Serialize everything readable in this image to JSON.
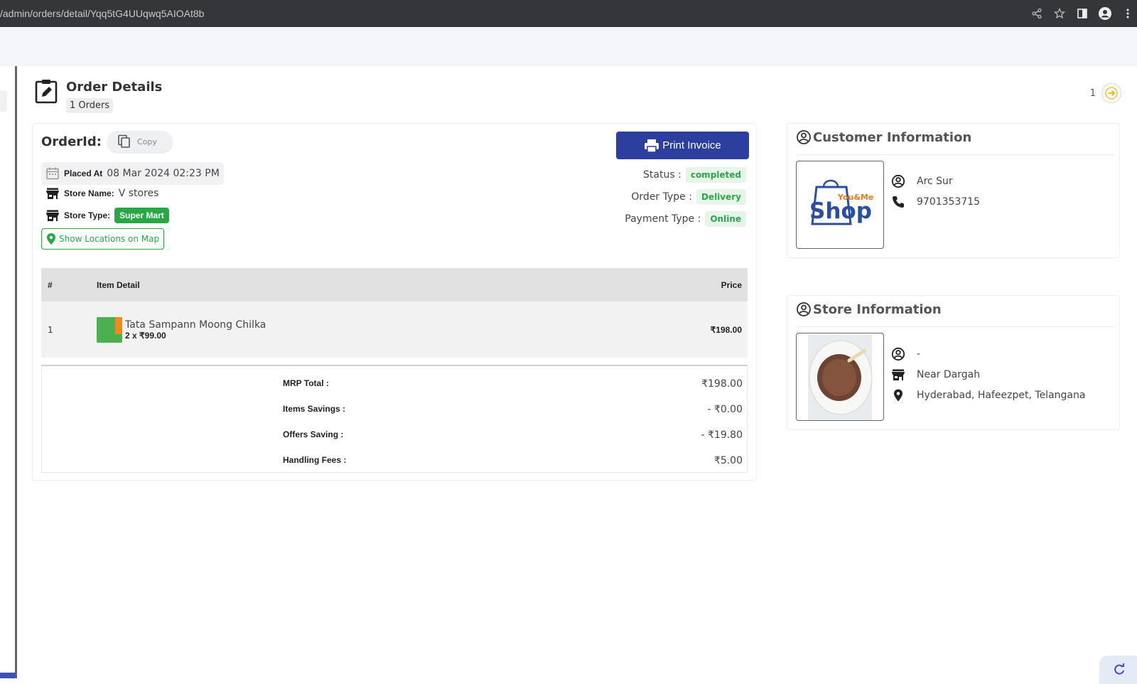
{
  "browser": {
    "url": "/admin/orders/detail/Yqq5tG4UUqwq5AIOAt8b"
  },
  "header": {
    "title": "Order Details",
    "count": "1 Orders"
  },
  "pager": {
    "page": "1"
  },
  "order": {
    "id_label": "OrderId:",
    "copy_label": "Copy",
    "placed_label": "Placed At",
    "placed_value": "08 Mar 2024 02:23 PM",
    "store_name_label": "Store Name:",
    "store_name_value": "V stores",
    "store_type_label": "Store Type:",
    "store_type_value": "Super Mart",
    "map_button": "Show Locations on Map",
    "print_button": "Print Invoice",
    "status_label": "Status :",
    "status_value": "completed",
    "order_type_label": "Order Type :",
    "order_type_value": "Delivery",
    "payment_type_label": "Payment Type :",
    "payment_type_value": "Online"
  },
  "items_table": {
    "columns": [
      "#",
      "Item Detail",
      "Price"
    ],
    "rows": [
      {
        "index": "1",
        "name": "Tata Sampann Moong Chilka",
        "qty": "2 x ₹99.00",
        "price": "₹198.00"
      }
    ]
  },
  "totals": {
    "mrp_label": "MRP Total :",
    "mrp_value": "₹198.00",
    "items_savings_label": "Items Savings :",
    "items_savings_value": "- ₹0.00",
    "offers_saving_label": "Offers Saving :",
    "offers_saving_value": "- ₹19.80",
    "handling_label": "Handling Fees :",
    "handling_value": "₹5.00"
  },
  "customer": {
    "title": "Customer Information",
    "logo_text_small": "You&Me",
    "logo_text_big": "Shop",
    "name": "Arc Sur",
    "phone": "9701353715"
  },
  "store": {
    "title": "Store Information",
    "owner": "-",
    "name": "Near Dargah",
    "address": "Hyderabad, Hafeezpet, Telangana"
  },
  "colors": {
    "primary": "#2c3e9e",
    "success": "#28a745",
    "accent": "#f5b31c"
  },
  "icons": [
    "share-icon",
    "star-icon",
    "sidepanel-icon",
    "profile-icon",
    "menu-icon",
    "clipboard-edit-icon",
    "arrow-right-icon",
    "copy-icon",
    "calendar-icon",
    "store-icon",
    "pin-icon",
    "printer-icon",
    "user-circle-icon",
    "phone-icon",
    "refresh-icon"
  ]
}
